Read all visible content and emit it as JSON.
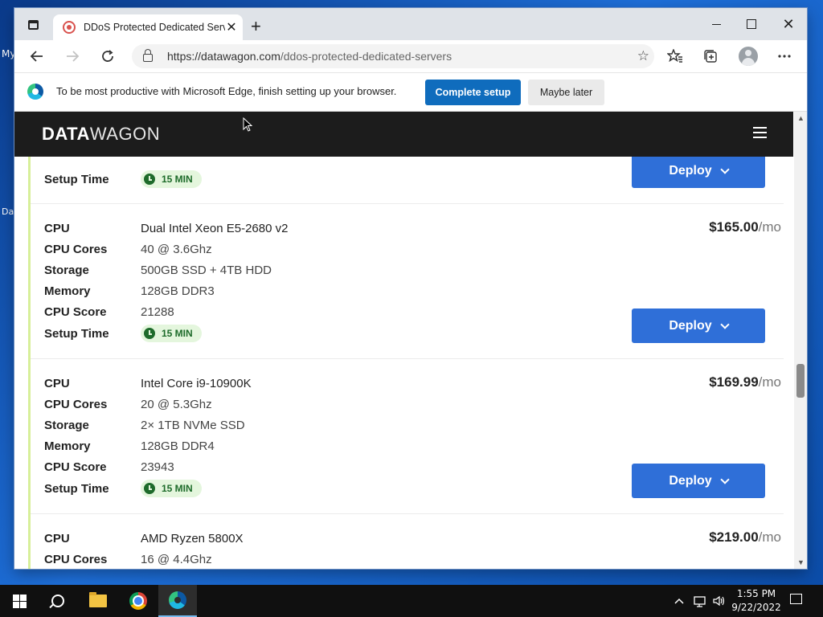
{
  "desktop": {
    "label_top": "My",
    "label_bottom": "Da"
  },
  "browser": {
    "tab_title": "DDoS Protected Dedicated Serve",
    "tab_close": "✕",
    "new_tab": "+",
    "url_host": "https://datawagon.com",
    "url_path": "/ddos-protected-dedicated-servers",
    "infobar_text": "To be most productive with Microsoft Edge, finish setting up your browser.",
    "complete_setup": "Complete setup",
    "maybe_later": "Maybe later",
    "icons": {
      "back": "arrow-left-icon",
      "forward": "arrow-right-icon",
      "refresh": "refresh-icon",
      "favorites": "favorites-icon",
      "collections": "collections-icon",
      "more": "more-icon"
    }
  },
  "site": {
    "logo_bold": "DATA",
    "logo_light": "WAGON",
    "menu_icon": "hamburger-icon"
  },
  "labels": {
    "cpu": "CPU",
    "cores": "CPU Cores",
    "storage": "Storage",
    "memory": "Memory",
    "score": "CPU Score",
    "setup": "Setup Time",
    "per": "/mo",
    "deploy": "Deploy"
  },
  "top_card": {
    "setup_time": "15 MIN"
  },
  "servers": [
    {
      "cpu": "Dual Intel Xeon E5-2680 v2",
      "cores": "40 @ 3.6Ghz",
      "storage": "500GB SSD + 4TB HDD",
      "memory": "128GB DDR3",
      "score": "21288",
      "setup_time": "15 MIN",
      "price": "$165.00"
    },
    {
      "cpu": "Intel Core i9-10900K",
      "cores": "20 @ 5.3Ghz",
      "storage": "2× 1TB NVMe SSD",
      "memory": "128GB DDR4",
      "score": "23943",
      "setup_time": "15 MIN",
      "price": "$169.99"
    },
    {
      "cpu": "AMD Ryzen 5800X",
      "cores": "16 @ 4.4Ghz",
      "price": "$219.00"
    }
  ],
  "taskbar": {
    "time": "1:55 PM",
    "date": "9/22/2022"
  }
}
